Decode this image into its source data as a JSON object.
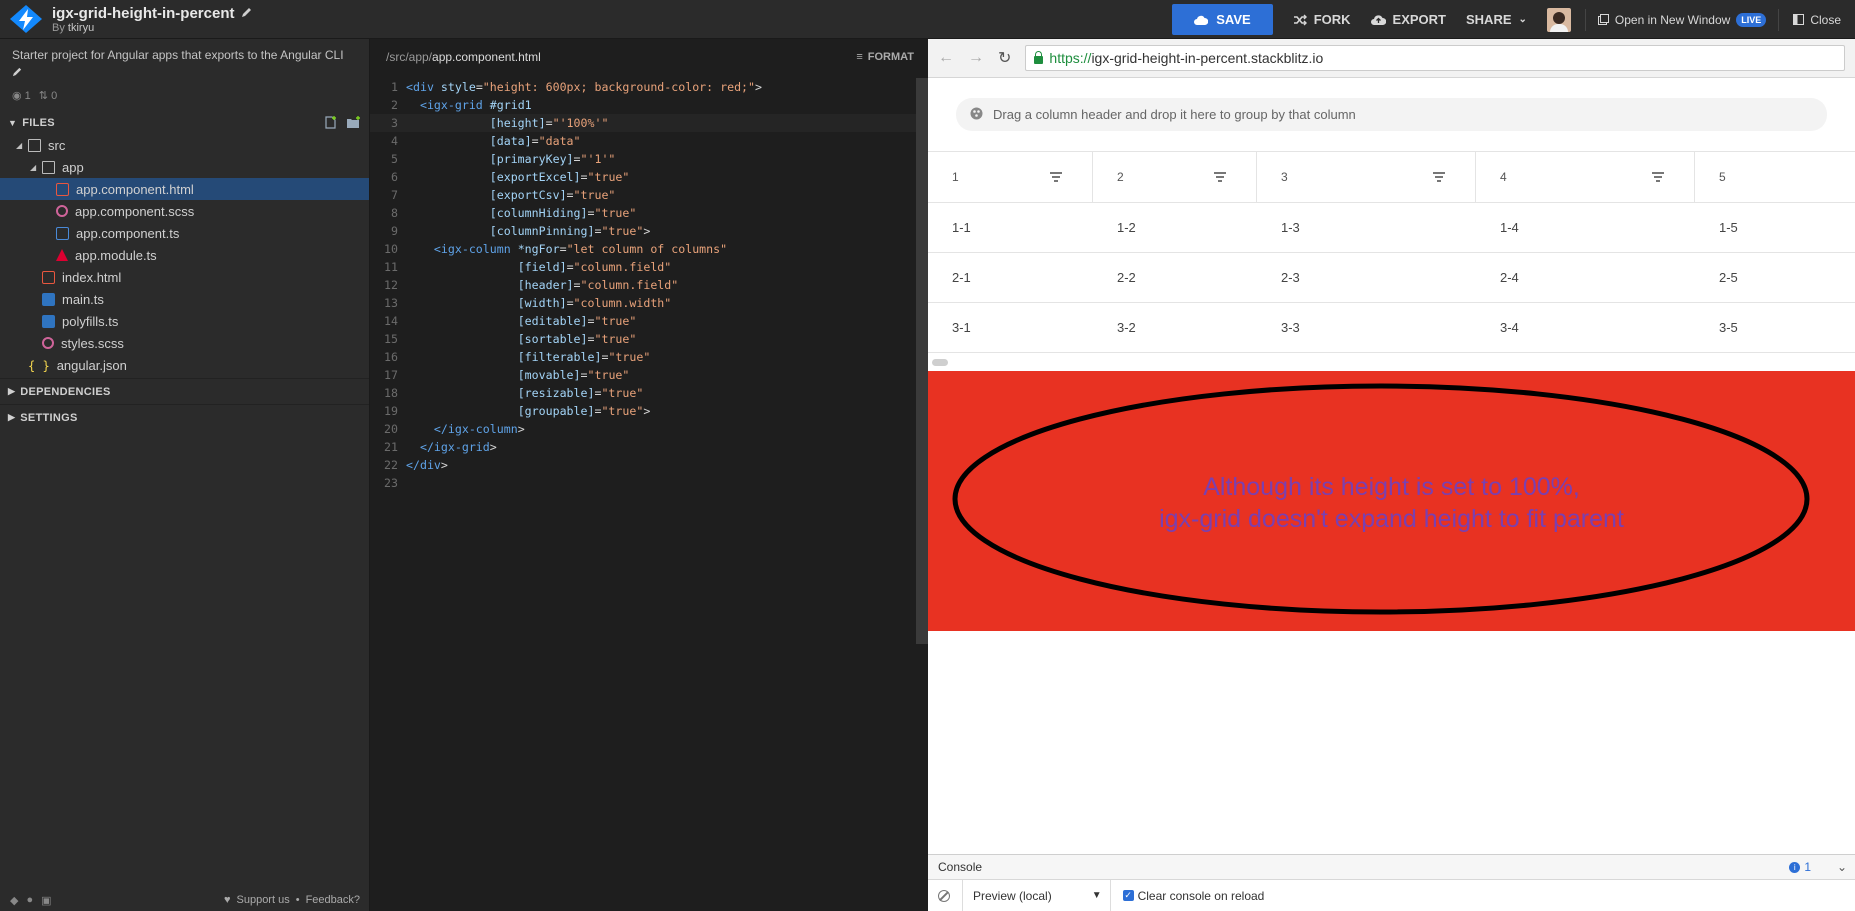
{
  "project": {
    "title": "igx-grid-height-in-percent",
    "by_prefix": "By",
    "author": "tkiryu",
    "description": "Starter project for Angular apps that exports to the Angular CLI",
    "views": "1",
    "forks": "0"
  },
  "toolbar": {
    "save": "SAVE",
    "fork": "FORK",
    "export": "EXPORT",
    "share": "SHARE",
    "open_new": "Open in New Window",
    "live": "LIVE",
    "close": "Close"
  },
  "sidebar": {
    "files_label": "FILES",
    "tree": [
      {
        "name": "src",
        "type": "folder",
        "depth": 1
      },
      {
        "name": "app",
        "type": "folder",
        "depth": 2
      },
      {
        "name": "app.component.html",
        "type": "html",
        "depth": 3,
        "selected": true
      },
      {
        "name": "app.component.scss",
        "type": "scss",
        "depth": 3
      },
      {
        "name": "app.component.ts",
        "type": "ts",
        "depth": 3
      },
      {
        "name": "app.module.ts",
        "type": "angular",
        "depth": 3
      },
      {
        "name": "index.html",
        "type": "html",
        "depth": 2
      },
      {
        "name": "main.ts",
        "type": "tsb",
        "depth": 2
      },
      {
        "name": "polyfills.ts",
        "type": "tsb",
        "depth": 2
      },
      {
        "name": "styles.scss",
        "type": "scss",
        "depth": 2
      },
      {
        "name": "angular.json",
        "type": "json",
        "depth": 1
      }
    ],
    "dependencies_label": "DEPENDENCIES",
    "settings_label": "SETTINGS",
    "support": "Support us",
    "feedback": "Feedback?"
  },
  "editor": {
    "path_prefix": "/src/app/",
    "filename": "app.component.html",
    "format_label": "FORMAT",
    "lines": [
      "<div style=\"height: 600px; background-color: red;\">",
      "  <igx-grid #grid1",
      "            [height]=\"'100%'\"",
      "            [data]=\"data\"",
      "            [primaryKey]=\"'1'\"",
      "            [exportExcel]=\"true\"",
      "            [exportCsv]=\"true\"",
      "            [columnHiding]=\"true\"",
      "            [columnPinning]=\"true\">",
      "    <igx-column *ngFor=\"let column of columns\"",
      "                [field]=\"column.field\"",
      "                [header]=\"column.field\"",
      "                [width]=\"column.width\"",
      "                [editable]=\"true\"",
      "                [sortable]=\"true\"",
      "                [filterable]=\"true\"",
      "                [movable]=\"true\"",
      "                [resizable]=\"true\"",
      "                [groupable]=\"true\">",
      "    </igx-column>",
      "  </igx-grid>",
      "</div>",
      ""
    ]
  },
  "preview": {
    "url_scheme": "https://",
    "url_host": "igx-grid-height-in-percent.stackblitz.io",
    "group_hint": "Drag a column header and drop it here to group by that column",
    "columns": [
      "1",
      "2",
      "3",
      "4",
      "5"
    ],
    "rows": [
      [
        "1-1",
        "1-2",
        "1-3",
        "1-4",
        "1-5"
      ],
      [
        "2-1",
        "2-2",
        "2-3",
        "2-4",
        "2-5"
      ],
      [
        "3-1",
        "3-2",
        "3-3",
        "3-4",
        "3-5"
      ]
    ],
    "note_line1": "Although its height is set to 100%,",
    "note_line2": "igx-grid doesn't expand height to fit parent"
  },
  "console": {
    "tab": "Console",
    "count": "1",
    "context": "Preview (local)",
    "clear_label": "Clear console on reload"
  },
  "colors": {
    "save_button": "#2d6fd6",
    "selected_file": "#254a77",
    "red_container": "#e83222",
    "note_text": "#7a40b0"
  }
}
